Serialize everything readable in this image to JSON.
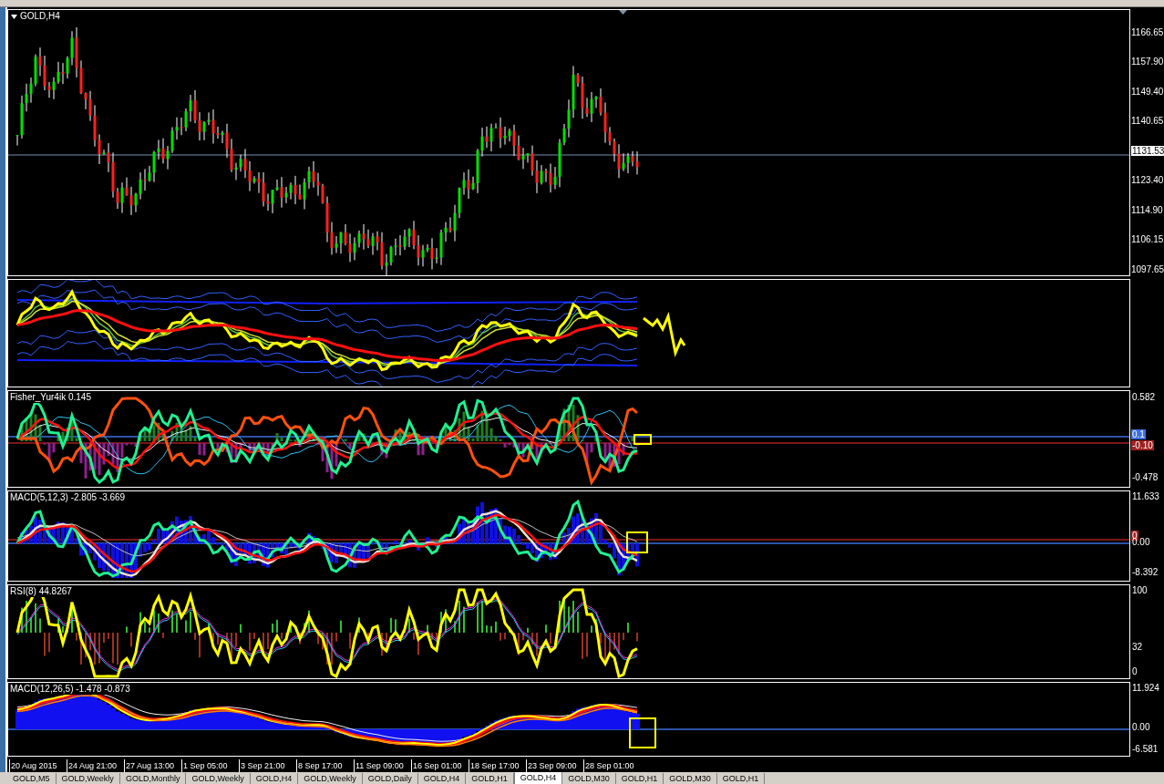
{
  "chart": {
    "title": "GOLD,H4",
    "price_axis": [
      "1166.65",
      "1157.90",
      "1149.40",
      "1140.65",
      "1123.40",
      "1114.90",
      "1106.15",
      "1097.65"
    ],
    "current_price": "1131.53"
  },
  "indicators": [
    {
      "kind": "bands"
    },
    {
      "kind": "fisher",
      "label": "Fisher_Yur4ik 0.145",
      "axis": [
        {
          "text": "0.582",
          "kind": "tick"
        },
        {
          "text": "0.1",
          "kind": "badge",
          "color": "#3c6ee0"
        },
        {
          "text": "-0.10",
          "kind": "badge",
          "color": "#a02020"
        },
        {
          "text": "-0.478",
          "kind": "tick"
        }
      ]
    },
    {
      "kind": "macd",
      "label": "MACD(5,12,3) -2.805 -3.669",
      "axis": [
        {
          "text": "11.633",
          "kind": "tick"
        },
        {
          "text": "0",
          "kind": "badge",
          "color": "#a02020"
        },
        {
          "text": "0.00",
          "kind": "tick"
        },
        {
          "text": "-8.392",
          "kind": "tick"
        }
      ]
    },
    {
      "kind": "rsi",
      "label": "RSI(8) 44.8267",
      "axis": [
        {
          "text": "100",
          "kind": "tick"
        },
        {
          "text": "32",
          "kind": "tick"
        },
        {
          "text": "0",
          "kind": "tick"
        }
      ]
    },
    {
      "kind": "macd_hist",
      "label": "MACD(12,26,5) -1.478 -0.873",
      "axis": [
        {
          "text": "11.924",
          "kind": "tick"
        },
        {
          "text": "0.00",
          "kind": "tick"
        },
        {
          "text": "-6.581",
          "kind": "tick"
        }
      ]
    }
  ],
  "time_axis": [
    "20 Aug 2015",
    "24 Aug 21:00",
    "27 Aug 13:00",
    "1 Sep 05:00",
    "3 Sep 21:00",
    "8 Sep 17:00",
    "11 Sep 09:00",
    "16 Sep 01:00",
    "18 Sep 17:00",
    "23 Sep 09:00",
    "28 Sep 01:00"
  ],
  "tabs": [
    {
      "label": "GOLD,M5",
      "selected": false
    },
    {
      "label": "GOLD,Weekly",
      "selected": false
    },
    {
      "label": "GOLD,Monthly",
      "selected": false
    },
    {
      "label": "GOLD,Weekly",
      "selected": false
    },
    {
      "label": "GOLD,H4",
      "selected": false
    },
    {
      "label": "GOLD,Weekly",
      "selected": false
    },
    {
      "label": "GOLD,Daily",
      "selected": false
    },
    {
      "label": "GOLD,H4",
      "selected": false
    },
    {
      "label": "GOLD,H1",
      "selected": false
    },
    {
      "label": "GOLD,H4",
      "selected": true
    },
    {
      "label": "GOLD,M30",
      "selected": false
    },
    {
      "label": "GOLD,H1",
      "selected": false
    },
    {
      "label": "GOLD,M30",
      "selected": false
    },
    {
      "label": "GOLD,H1",
      "selected": false
    }
  ]
}
